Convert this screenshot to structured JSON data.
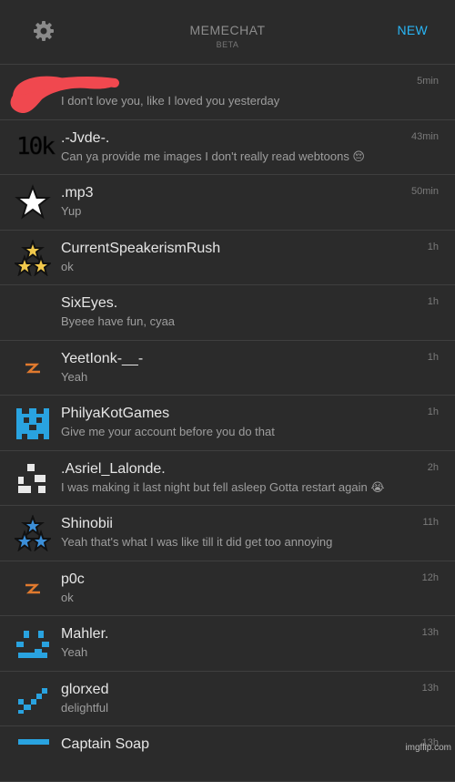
{
  "header": {
    "title": "MEMECHAT",
    "subtitle": "BETA",
    "new_label": "NEW",
    "settings_icon": "gear-icon"
  },
  "colors": {
    "background": "#2b2b2b",
    "accent": "#29b6f6",
    "divider": "#3f3f3f"
  },
  "chats": [
    {
      "name": "",
      "message": "I don't love you, like I loved you yesterday",
      "time": "5min",
      "avatar": "redacted-scribble"
    },
    {
      "name": ".-Jvde-.",
      "message": "Can ya provide me images I don't really read webtoons 😔",
      "time": "43min",
      "avatar": "10k-text",
      "avatar_text": "10k"
    },
    {
      "name": ".mp3",
      "message": "Yup",
      "time": "50min",
      "avatar": "star-icon"
    },
    {
      "name": "CurrentSpeakerismRush",
      "message": "ok",
      "time": "1h",
      "avatar": "gold-triple-star-icon"
    },
    {
      "name": "SixEyes.",
      "message": "Byeee have fun, cyaa",
      "time": "1h",
      "avatar": "none"
    },
    {
      "name": "YeetIonk-__-",
      "message": "Yeah",
      "time": "1h",
      "avatar": "orange-bolt-icon"
    },
    {
      "name": "PhilyaKotGames",
      "message": "Give me your account before you do that",
      "time": "1h",
      "avatar": "blue-pixel-face-icon"
    },
    {
      "name": ".Asriel_Lalonde.",
      "message": "I was making it last night but fell asleep Gotta restart again 😭",
      "time": "2h",
      "avatar": "pixel-ghost-icon"
    },
    {
      "name": "Shinobii",
      "message": "Yeah that's what I was like till it did get too annoying",
      "time": "11h",
      "avatar": "blue-triple-star-icon"
    },
    {
      "name": "p0c",
      "message": "ok",
      "time": "12h",
      "avatar": "orange-bolt-icon"
    },
    {
      "name": "Mahler.",
      "message": "Yeah",
      "time": "13h",
      "avatar": "blue-pixel-smile-icon"
    },
    {
      "name": "glorxed",
      "message": "delightful",
      "time": "13h",
      "avatar": "blue-pixel-check-icon"
    },
    {
      "name": "Captain Soap",
      "message": "",
      "time": "13h",
      "avatar": "blue-pixel-bar-icon"
    }
  ],
  "watermark": "imgflip.com"
}
